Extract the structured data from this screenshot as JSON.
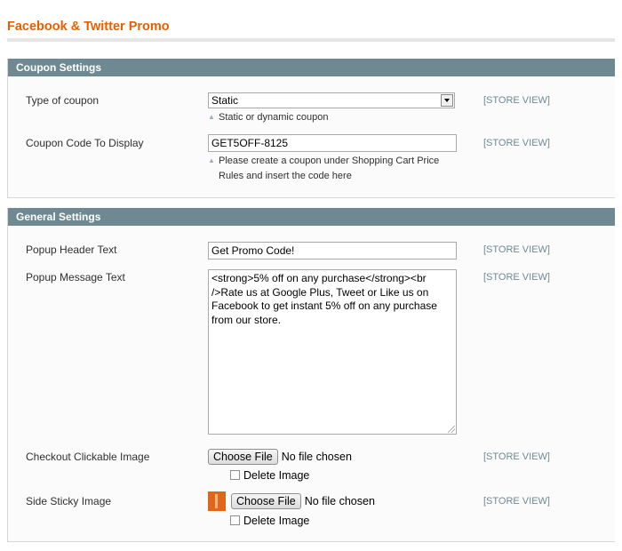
{
  "page": {
    "title": "Facebook & Twitter Promo"
  },
  "coupon_settings": {
    "heading": "Coupon Settings",
    "type_of_coupon": {
      "label": "Type of coupon",
      "value": "Static",
      "note": "Static or dynamic coupon",
      "scope": "[STORE VIEW]"
    },
    "coupon_code": {
      "label": "Coupon Code To Display",
      "value": "GET5OFF-8125",
      "note_line1": "Please create a coupon under Shopping Cart Price",
      "note_line2": "Rules and insert the code here",
      "scope": "[STORE VIEW]"
    }
  },
  "general_settings": {
    "heading": "General Settings",
    "popup_header": {
      "label": "Popup Header Text",
      "value": "Get Promo Code!",
      "scope": "[STORE VIEW]"
    },
    "popup_message": {
      "label": "Popup Message Text",
      "value": "<strong>5% off on any purchase</strong><br />Rate us at Google Plus, Tweet or Like us on Facebook to get instant 5% off on any purchase from our store.",
      "scope": "[STORE VIEW]"
    },
    "checkout_image": {
      "label": "Checkout Clickable Image",
      "button": "Choose File",
      "file_status": "No file chosen",
      "delete_label": "Delete Image",
      "scope": "[STORE VIEW]"
    },
    "side_sticky_image": {
      "label": "Side Sticky Image",
      "button": "Choose File",
      "file_status": "No file chosen",
      "delete_label": "Delete Image",
      "scope": "[STORE VIEW]"
    }
  },
  "colors": {
    "title": "#eb5e00",
    "section_header_bg": "#6f8992",
    "scope_text": "#6f8992",
    "thumbnail": "#e0661a"
  },
  "icons": {
    "note_marker": "triangle-up-icon",
    "select_arrow": "chevron-down-icon",
    "image_thumbnail": "image-thumbnail"
  }
}
